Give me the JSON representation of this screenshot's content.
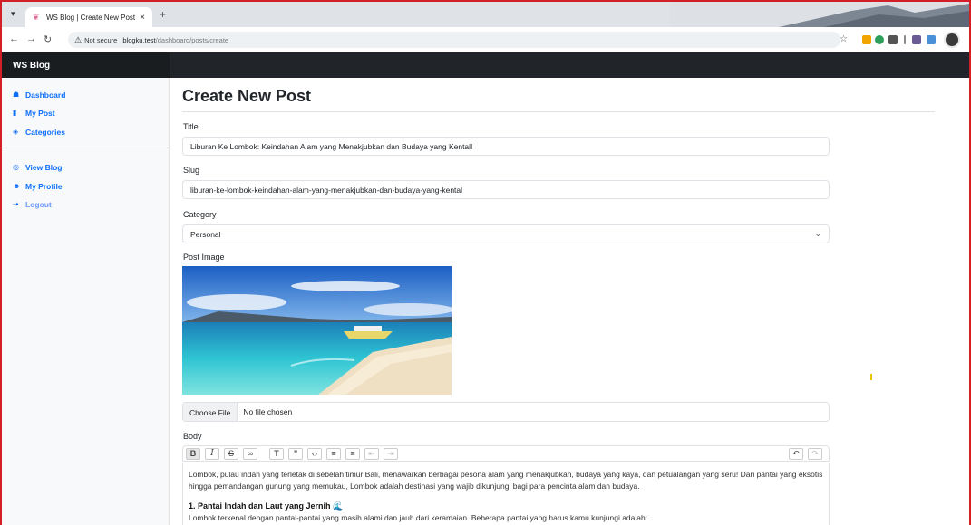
{
  "browser": {
    "tab_title": "WS Blog | Create New Post",
    "not_secure": "Not secure",
    "url_host": "blogku.test",
    "url_path": "/dashboard/posts/create"
  },
  "app": {
    "brand": "WS Blog"
  },
  "sidebar": {
    "items": [
      {
        "label": "Dashboard",
        "icon": "house-icon"
      },
      {
        "label": "My Post",
        "icon": "file-icon"
      },
      {
        "label": "Categories",
        "icon": "tag-icon"
      }
    ],
    "items2": [
      {
        "label": "View Blog",
        "icon": "globe-icon"
      },
      {
        "label": "My Profile",
        "icon": "person-icon"
      },
      {
        "label": "Logout",
        "icon": "logout-icon"
      }
    ]
  },
  "page": {
    "title": "Create New Post"
  },
  "form": {
    "title_label": "Title",
    "title_value": "Liburan Ke Lombok: Keindahan Alam yang Menakjubkan dan Budaya yang Kental!",
    "slug_label": "Slug",
    "slug_value": "liburan-ke-lombok-keindahan-alam-yang-menakjubkan-dan-budaya-yang-kental",
    "category_label": "Category",
    "category_value": "Personal",
    "image_label": "Post Image",
    "file_button": "Choose File",
    "file_status": "No file chosen",
    "body_label": "Body",
    "body_p1": "Lombok, pulau indah yang terletak di sebelah timur Bali, menawarkan berbagai pesona alam yang menakjubkan, budaya yang kaya, dan petualangan yang seru! Dari pantai yang eksotis hingga pemandangan gunung yang memukau, Lombok adalah destinasi yang wajib dikunjungi bagi para pencinta alam dan budaya.",
    "body_h1": "1. Pantai Indah dan Laut yang Jernih",
    "body_p2": "Lombok terkenal dengan pantai-pantai yang masih alami dan jauh dari keramaian. Beberapa pantai yang harus kamu kunjungi adalah:"
  },
  "colors": {
    "accent": "#0d6efd",
    "navbar": "#212529",
    "frame": "#d41f26"
  }
}
